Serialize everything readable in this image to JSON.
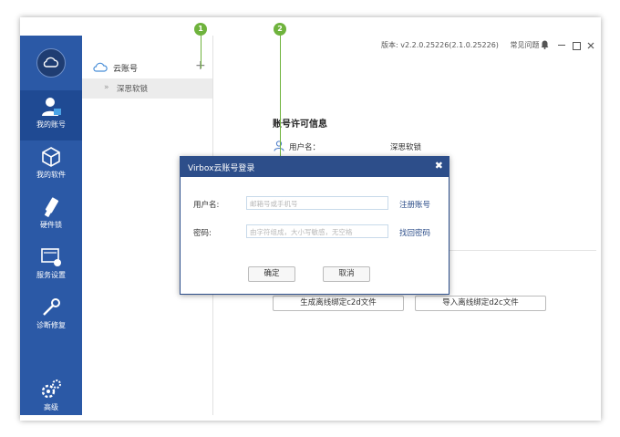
{
  "topbar": {
    "version": "版本: v2.2.0.25226(2.1.0.25226)",
    "help": "常见问题"
  },
  "sidebar": {
    "items": [
      {
        "label": "我的账号",
        "icon": "user-icon"
      },
      {
        "label": "我的软件",
        "icon": "cube-icon"
      },
      {
        "label": "硬件锁",
        "icon": "usb-key-icon"
      },
      {
        "label": "服务设置",
        "icon": "server-settings-icon"
      },
      {
        "label": "诊断修复",
        "icon": "repair-icon"
      },
      {
        "label": "高级",
        "icon": "gears-icon"
      }
    ]
  },
  "panel": {
    "header": "云账号",
    "add": "+",
    "sub_item": "深思软锁",
    "chevron": "»"
  },
  "main": {
    "title": "账号许可信息",
    "username_label": "用户名：",
    "username_value": "深思软锁",
    "button_generate": "生成离线绑定c2d文件",
    "button_import": "导入离线绑定d2c文件"
  },
  "markers": [
    "1",
    "2"
  ],
  "dialog": {
    "title": "Virbox云账号登录",
    "close": "✖",
    "username_label": "用户名:",
    "username_placeholder": "邮箱号或手机号",
    "register_link": "注册账号",
    "password_label": "密码:",
    "password_placeholder": "由字符组成，大小写敏感，无空格",
    "forgot_link": "找回密码",
    "ok": "确定",
    "cancel": "取消"
  },
  "colors": {
    "sidebar": "#2b59a6",
    "dialog_title": "#2d4e8a",
    "marker": "#6fb33d"
  }
}
